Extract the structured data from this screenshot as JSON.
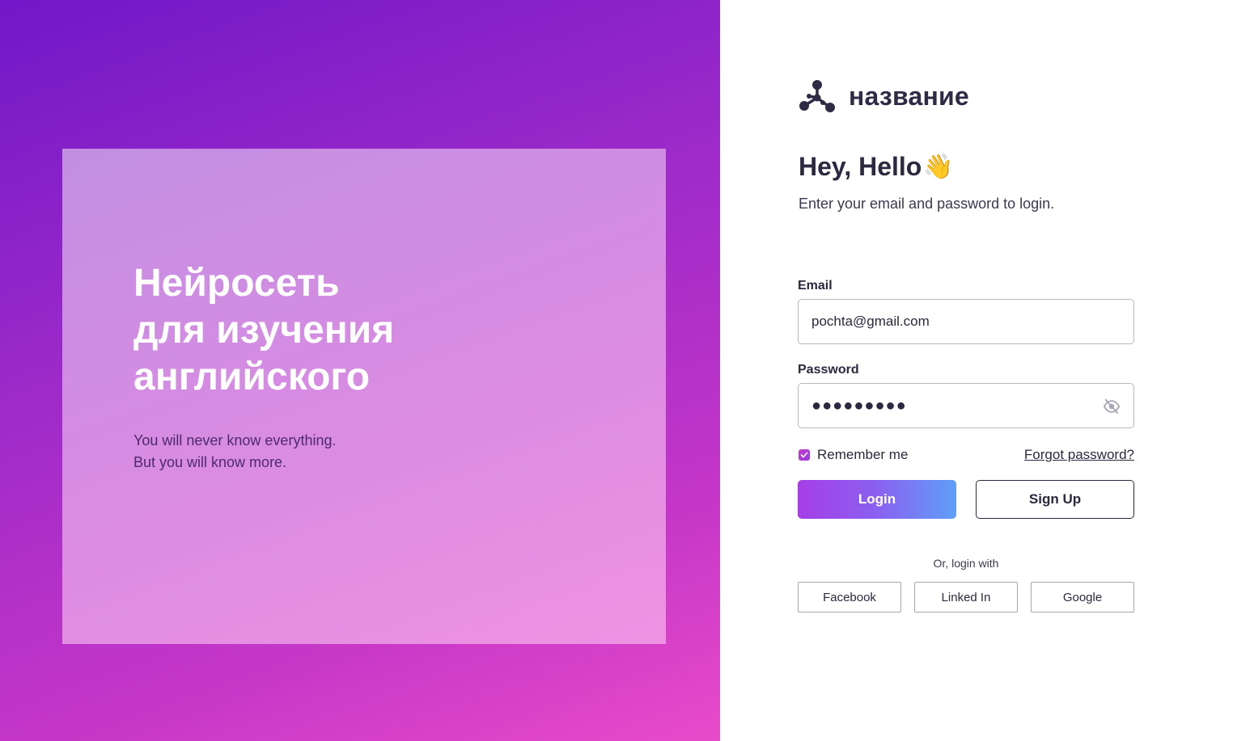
{
  "hero": {
    "title_lines": [
      "Нейросеть",
      "для изучения",
      "английского"
    ],
    "subtitle_lines": [
      "You will never know everything.",
      "But you will know more."
    ]
  },
  "brand": {
    "name": "название",
    "icon": "network-logo-icon"
  },
  "greeting": {
    "title": "Hey, Hello",
    "emoji": "👋",
    "instruction": "Enter your email and password to login."
  },
  "form": {
    "email_label": "Email",
    "email_value": "pochta@gmail.com",
    "password_label": "Password",
    "password_value": "●●●●●●●●●",
    "password_icon": "eye-off-icon",
    "remember_label": "Remember me",
    "remember_checked": true,
    "forgot_label": "Forgot password?",
    "login_label": "Login",
    "signup_label": "Sign Up"
  },
  "social": {
    "or_text": "Or, login with",
    "buttons": [
      "Facebook",
      "Linked In",
      "Google"
    ]
  },
  "colors": {
    "accent_start": "#a63ee6",
    "accent_end": "#5f9ff8",
    "text_dark": "#2b2840",
    "bg_gradient_start": "#7118c8",
    "bg_gradient_end": "#e84bc9"
  }
}
